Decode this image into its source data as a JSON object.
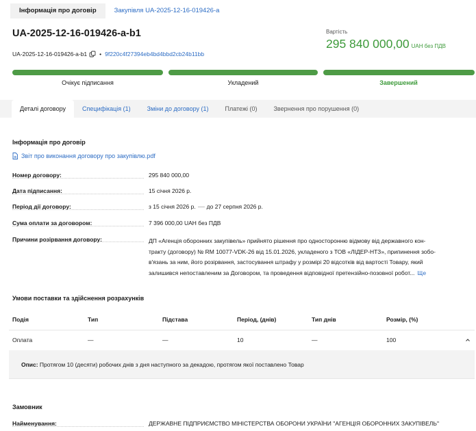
{
  "top_tabs": [
    "Інформація про договір",
    "Закупівля UA-2025-12-16-019426-a"
  ],
  "header": {
    "contract_id": "UA-2025-12-16-019426-a-b1",
    "sub_id": "UA-2025-12-16-019426-a-b1",
    "separator": "•",
    "hash": "9f220c4f27394eb4bd4bbd2cb24b11bb"
  },
  "value": {
    "label": "Вартість",
    "amount": "295 840 000,00",
    "note": "UAH без ПДВ"
  },
  "stages": [
    {
      "label": "Очікує підписання",
      "done": false
    },
    {
      "label": "Укладений",
      "done": false
    },
    {
      "label": "Завершений",
      "done": true
    }
  ],
  "colors": {
    "accent_green": "#3d9a3a",
    "progress_green": "#4e9b46",
    "link_blue": "#2c6cc4"
  },
  "tabs": [
    {
      "label": "Деталі договору"
    },
    {
      "label": "Специфікація (1)"
    },
    {
      "label": "Зміни до договору (1)"
    },
    {
      "label": "Платежі (0)"
    },
    {
      "label": "Звернення про порушення (0)"
    }
  ],
  "contract_info": {
    "title": "Інформація про договір",
    "document": "Звіт про виконання договору про закупівлю.pdf",
    "rows": [
      {
        "label": "Номер договору:",
        "value": "295 840 000,00"
      },
      {
        "label": "Дата підписання:",
        "value": "15 січня 2026 р."
      },
      {
        "label": "Період дії договору:",
        "from": "з 15 січня 2026 р.",
        "to": "до 27 серпня 2026 р."
      },
      {
        "label": "Сума оплати за договором:",
        "value": "7 396 000,00 UAH без ПДВ"
      },
      {
        "label": "Причини розірвання договору:"
      }
    ],
    "reason_lines": [
      "ДП «Агенція оборонних закупівель» прийнято рішення про односторонню відмову від державного кон-",
      "тракту (договору) № RM 10077-VDK-26 від 15.01.2026, укладеного з ТОВ «ЛІДЕР-НТЗ», припинення зобо-",
      "в'язань за ним, його розірвання, застосування штрафу у розмірі 20 відсотків від вартості Товару, який",
      "залишився непоставленим за Договором, та проведення відповідної претензійно-позовної робот..."
    ],
    "more": "Ще"
  },
  "delivery": {
    "title": "Умови поставки та здійснення розрахунків",
    "headers": [
      "Подія",
      "Тип",
      "Підстава",
      "Період, (днів)",
      "Тип днів",
      "Розмір, (%)"
    ],
    "row": [
      "Оплата",
      "—",
      "—",
      "10",
      "—",
      "100"
    ],
    "desc_label": "Опис:",
    "desc_text": "Протягом 10 (десяти) робочих днів з дня наступного за декадою, протягом якої поставлено Товар"
  },
  "buyer": {
    "title": "Замовник",
    "name_label": "Найменування:",
    "name_value": "ДЕРЖАВНЕ ПІДПРИЄМСТВО МІНІСТЕРСТВА ОБОРОНИ УКРАЇНИ \"АГЕНЦІЯ ОБОРОННИХ ЗАКУПІВЕЛЬ\""
  }
}
